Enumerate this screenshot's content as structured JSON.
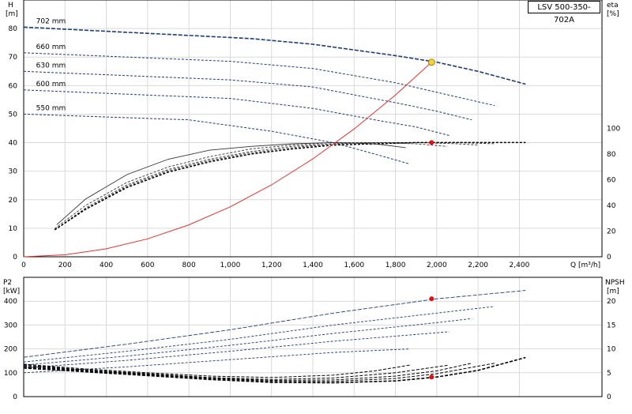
{
  "model_label": "LSV 500-350-702A",
  "chart_data": [
    {
      "type": "line",
      "title": "",
      "xlabel": "Q [m³/h]",
      "xlim": [
        0,
        2800
      ],
      "xticks": [
        0,
        200,
        400,
        600,
        800,
        1000,
        1200,
        1400,
        1600,
        1800,
        2000,
        2200,
        2400
      ],
      "xtick_labels": [
        "0",
        "200",
        "400",
        "600",
        "800",
        "1,000",
        "1,200",
        "1,400",
        "1,600",
        "1,800",
        "2,000",
        "2,200",
        "2,400"
      ],
      "ylabel_left": [
        "H",
        "[m]"
      ],
      "ylim_left": [
        0,
        90
      ],
      "yticks_left": [
        0,
        10,
        20,
        30,
        40,
        50,
        60,
        70,
        80
      ],
      "ylabel_right": [
        "eta",
        "[%]"
      ],
      "ylim_right": [
        0,
        200
      ],
      "yticks_right": [
        0,
        20,
        40,
        60,
        80,
        100
      ],
      "grid": true,
      "head_curves": [
        {
          "name": "702 mm",
          "x": [
            0,
            1100,
            1400,
            1800,
            2000,
            2200,
            2430
          ],
          "y": [
            80.5,
            76.5,
            74.5,
            70.5,
            68.2,
            65.0,
            60.5
          ]
        },
        {
          "name": "660 mm",
          "x": [
            0,
            1000,
            1400,
            1800,
            2100,
            2280
          ],
          "y": [
            71.5,
            68.5,
            66.0,
            61.0,
            56.0,
            53.0
          ]
        },
        {
          "name": "630 mm",
          "x": [
            0,
            1000,
            1400,
            1800,
            2000,
            2170
          ],
          "y": [
            65.0,
            62.0,
            59.5,
            54.0,
            51.0,
            48.0
          ]
        },
        {
          "name": "600 mm",
          "x": [
            0,
            1000,
            1400,
            1700,
            1900,
            2060
          ],
          "y": [
            58.5,
            55.5,
            52.0,
            48.0,
            45.5,
            42.5
          ]
        },
        {
          "name": "550 mm",
          "x": [
            0,
            800,
            1200,
            1500,
            1700,
            1870
          ],
          "y": [
            50.0,
            48.0,
            44.0,
            40.0,
            36.0,
            32.5
          ]
        }
      ],
      "efficiency_curves": [
        {
          "x": [
            160,
            300,
            500,
            700,
            900,
            1100,
            1300,
            1500,
            1700,
            1850
          ],
          "y": [
            25,
            45,
            64,
            76,
            83,
            86,
            88,
            89,
            88,
            85
          ]
        },
        {
          "x": [
            150,
            300,
            500,
            700,
            900,
            1100,
            1300,
            1500,
            1700,
            1900,
            2050
          ],
          "y": [
            22,
            40,
            58,
            70,
            78,
            84,
            87,
            89,
            89,
            88,
            86
          ]
        },
        {
          "x": [
            150,
            300,
            500,
            700,
            900,
            1100,
            1300,
            1500,
            1700,
            1900,
            2100,
            2200
          ],
          "y": [
            21,
            38,
            56,
            68,
            76,
            82,
            86,
            88,
            89,
            89,
            88,
            87
          ]
        },
        {
          "x": [
            150,
            300,
            500,
            700,
            900,
            1100,
            1300,
            1500,
            1700,
            1900,
            2100,
            2280
          ],
          "y": [
            21,
            37,
            55,
            67,
            75,
            81,
            85,
            88,
            89,
            89,
            89,
            88
          ]
        },
        {
          "x": [
            150,
            300,
            500,
            700,
            900,
            1100,
            1300,
            1500,
            1700,
            1900,
            2100,
            2300,
            2430
          ],
          "y": [
            21,
            37,
            54,
            66,
            74,
            80,
            84,
            87,
            88,
            89,
            89,
            89,
            89
          ]
        }
      ],
      "system_curve": {
        "x": [
          0,
          200,
          400,
          600,
          800,
          1000,
          1200,
          1400,
          1600,
          1800,
          1975
        ],
        "y": [
          0,
          0.7,
          2.8,
          6.3,
          11.2,
          17.5,
          25.2,
          34.3,
          44.8,
          56.7,
          68.2
        ]
      },
      "duty_point": {
        "x": 1975,
        "head": 68.2,
        "eta": 89
      },
      "colors": {
        "curve": "#1f3b73",
        "system": "#e83030",
        "duty_point": "#f2d43a",
        "eta_point": "#e01010",
        "grid": "#d9d9d9"
      }
    },
    {
      "type": "line",
      "title": "",
      "xlim": [
        0,
        2800
      ],
      "ylabel_left": [
        "P2",
        "[kW]"
      ],
      "ylim_left": [
        0,
        500
      ],
      "yticks_left": [
        0,
        100,
        200,
        300,
        400
      ],
      "ylabel_right": [
        "NPSH",
        "[m]"
      ],
      "ylim_right": [
        0,
        25
      ],
      "yticks_right": [
        0,
        5,
        10,
        15,
        20
      ],
      "grid": true,
      "power_curves": [
        {
          "x": [
            0,
            500,
            1000,
            1500,
            2000,
            2430
          ],
          "y": [
            165,
            220,
            280,
            350,
            410,
            445
          ]
        },
        {
          "x": [
            0,
            500,
            1000,
            1500,
            2000,
            2280
          ],
          "y": [
            145,
            190,
            240,
            300,
            350,
            378
          ]
        },
        {
          "x": [
            0,
            500,
            1000,
            1500,
            2000,
            2170
          ],
          "y": [
            132,
            170,
            215,
            265,
            310,
            327
          ]
        },
        {
          "x": [
            0,
            500,
            1000,
            1500,
            2060
          ],
          "y": [
            120,
            152,
            190,
            232,
            272
          ]
        },
        {
          "x": [
            0,
            500,
            1000,
            1500,
            1870
          ],
          "y": [
            100,
            125,
            155,
            185,
            200
          ]
        }
      ],
      "npsh_curves": [
        {
          "x": [
            0,
            300,
            600,
            900,
            1200,
            1500,
            1800,
            2000,
            2200,
            2430
          ],
          "y": [
            6.0,
            5.2,
            4.4,
            3.6,
            3.0,
            2.9,
            3.3,
            4.1,
            5.5,
            8.2
          ]
        },
        {
          "x": [
            0,
            300,
            600,
            900,
            1200,
            1500,
            1800,
            2000,
            2280
          ],
          "y": [
            6.2,
            5.4,
            4.6,
            3.8,
            3.2,
            3.2,
            3.8,
            4.8,
            7.0
          ]
        },
        {
          "x": [
            0,
            300,
            600,
            900,
            1200,
            1500,
            1800,
            2000,
            2170
          ],
          "y": [
            6.4,
            5.5,
            4.7,
            3.9,
            3.4,
            3.5,
            4.3,
            5.4,
            7.0
          ]
        },
        {
          "x": [
            0,
            300,
            600,
            900,
            1200,
            1500,
            1800,
            2060
          ],
          "y": [
            6.6,
            5.6,
            4.8,
            4.0,
            3.6,
            3.9,
            5.0,
            6.6
          ]
        },
        {
          "x": [
            0,
            300,
            600,
            900,
            1200,
            1500,
            1700,
            1870
          ],
          "y": [
            6.8,
            5.8,
            5.0,
            4.3,
            4.0,
            4.5,
            5.4,
            6.6
          ]
        }
      ],
      "power_point": {
        "x": 1975,
        "y": 410
      },
      "npsh_point": {
        "x": 1975,
        "y": 4.1
      }
    }
  ]
}
